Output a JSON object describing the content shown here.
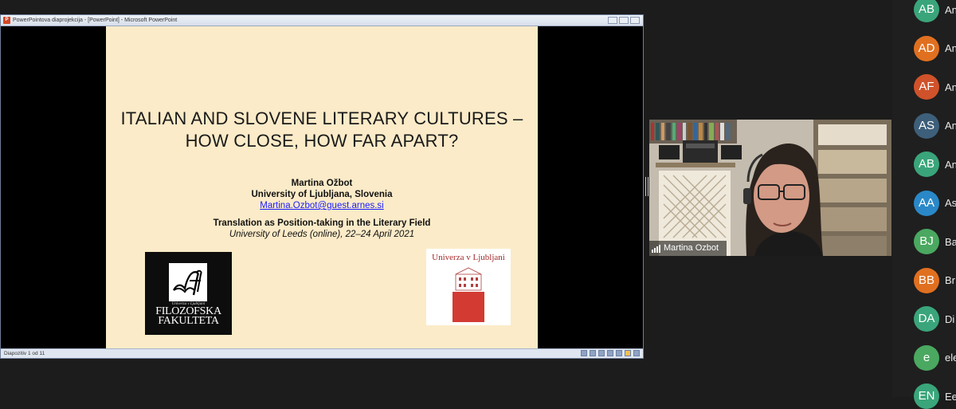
{
  "ppt": {
    "window_title": "PowerPointova diaprojekcija - [PowerPoint] - Microsoft PowerPoint",
    "app_icon_letter": "P",
    "status_text": "Diapozitiv 1 od 11"
  },
  "slide": {
    "title_line1": "ITALIAN AND SLOVENE LITERARY CULTURES –",
    "title_line2": "HOW CLOSE, HOW FAR APART?",
    "author": "Martina Ožbot",
    "affiliation": "University of Ljubljana, Slovenia",
    "email": "Martina.Ozbot@guest.arnes.si",
    "conference": "Translation  as Position-taking  in the Literary Field",
    "conference_detail": "University of Leeds (online), 22–24 April 2021",
    "logo_left_small": "Univerza v Ljubljani",
    "logo_left_text_line1": "FILOZOFSKA",
    "logo_left_text_line2": "FAKULTETA",
    "logo_right_text": "Univerza v Ljubljani"
  },
  "video": {
    "participant_name": "Martina Ozbot"
  },
  "participants": [
    {
      "initials": "AB",
      "name": "An",
      "color": "#3aa57a"
    },
    {
      "initials": "AD",
      "name": "An",
      "color": "#e07020"
    },
    {
      "initials": "AF",
      "name": "An",
      "color": "#d0522a"
    },
    {
      "initials": "AS",
      "name": "An",
      "color": "#3e5f7a"
    },
    {
      "initials": "AB",
      "name": "An",
      "color": "#3aa57a"
    },
    {
      "initials": "AA",
      "name": "As",
      "color": "#2a88c8"
    },
    {
      "initials": "BJ",
      "name": "Ba",
      "color": "#4aa860"
    },
    {
      "initials": "BB",
      "name": "Br",
      "color": "#e07020"
    },
    {
      "initials": "DA",
      "name": "Di",
      "color": "#3aa57a"
    },
    {
      "initials": "e",
      "name": "ele",
      "color": "#4aa860"
    },
    {
      "initials": "EN",
      "name": "Ee",
      "color": "#3aa57a"
    }
  ]
}
